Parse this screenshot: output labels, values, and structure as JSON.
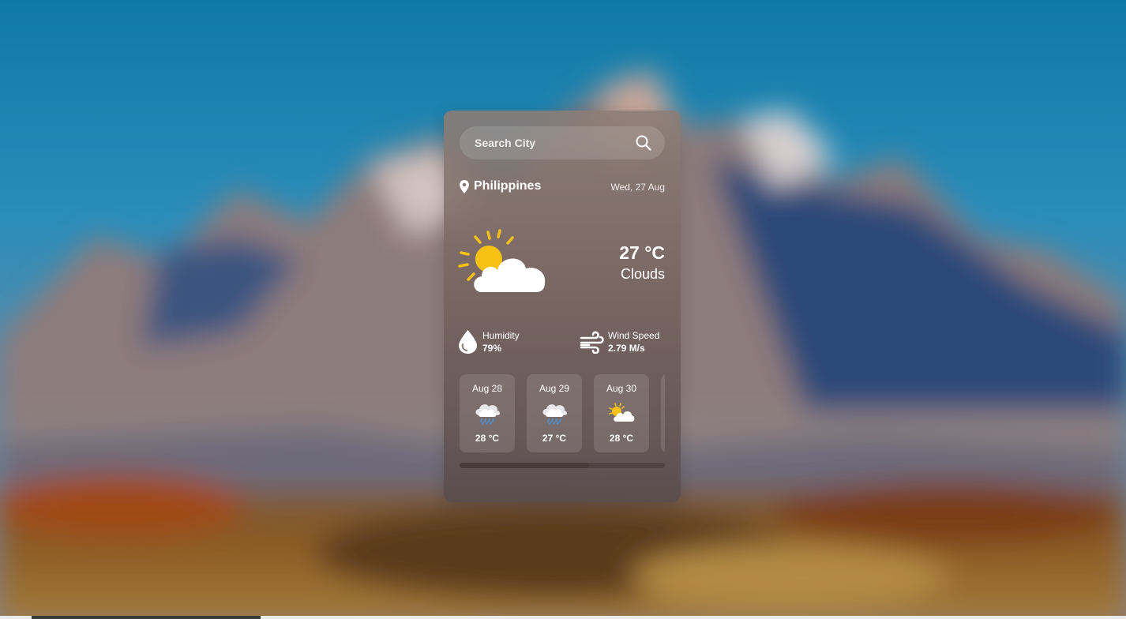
{
  "search": {
    "placeholder": "Search City",
    "icon": "search-icon"
  },
  "location": {
    "city": "Philippines",
    "date": "Wed, 27 Aug",
    "icon": "map-pin-icon"
  },
  "current": {
    "temperature": "27 °C",
    "condition": "Clouds",
    "icon": "sun-cloud-icon"
  },
  "stats": {
    "humidity": {
      "label": "Humidity",
      "value": "79%",
      "icon": "droplet-icon"
    },
    "wind": {
      "label": "Wind Speed",
      "value": "2.79 M/s",
      "icon": "wind-icon"
    }
  },
  "forecast": [
    {
      "date": "Aug 28",
      "temp": "28 °C",
      "icon": "rain-cloud-icon"
    },
    {
      "date": "Aug 29",
      "temp": "27 °C",
      "icon": "rain-cloud-icon"
    },
    {
      "date": "Aug 30",
      "temp": "28 °C",
      "icon": "sun-cloud-icon"
    }
  ],
  "forecast_scroll_position": 0.63,
  "colors": {
    "sun": "#f5c214",
    "cloud": "#ffffff",
    "rain": "#4a90d9",
    "sky": "#1f7fb0"
  }
}
